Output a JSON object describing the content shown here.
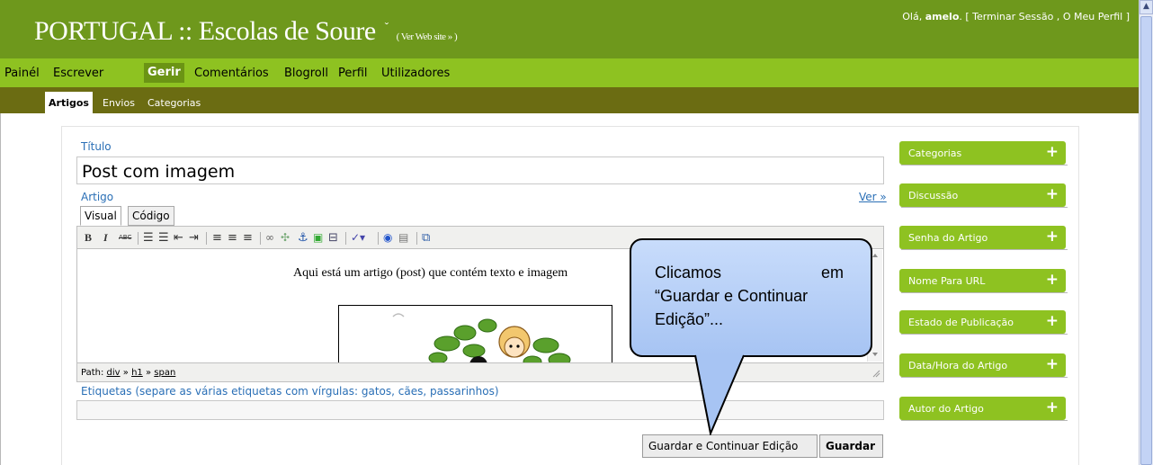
{
  "header": {
    "blog_title": "PORTUGAL :: Escolas de Soure",
    "caret": "ˇ",
    "view_site": "( Ver Web site » )",
    "greeting": "Olá,",
    "user": "amelo",
    "logout": "[ Terminar Sessão ,",
    "profile": "O Meu Perfil ]"
  },
  "mainnav": [
    "Painél",
    "Escrever",
    "Gerir",
    "Comentários",
    "Blogroll",
    "Perfil",
    "Utilizadores"
  ],
  "subnav": [
    "Artigos",
    "Envios",
    "Categorias"
  ],
  "form": {
    "title_label": "Título",
    "title_value": "Post com imagem",
    "article_label": "Artigo",
    "preview_link": "Ver »",
    "tab_visual": "Visual",
    "tab_code": "Código",
    "editor_text": "Aqui está um artigo (post) que contém texto e imagem",
    "path_label": "Path:",
    "path_div": "div",
    "path_h1": "h1",
    "path_span": "span",
    "path_sep": "»",
    "tags_label": "Etiquetas (separe as várias etiquetas com vírgulas: gatos, cães, passarinhos)",
    "tags_value": ""
  },
  "toolbar_icons": [
    "bold-icon",
    "italic-icon",
    "strikethrough-icon",
    "bullet-list-icon",
    "numbered-list-icon",
    "outdent-icon",
    "indent-icon",
    "align-left-icon",
    "align-center-icon",
    "align-right-icon",
    "link-icon",
    "unlink-icon",
    "anchor-icon",
    "image-icon",
    "more-break-icon",
    "spellcheck-icon",
    "help-icon",
    "wordcount-icon",
    "fullscreen-icon"
  ],
  "buttons": {
    "save_continue": "Guardar e Continuar Edição",
    "save": "Guardar"
  },
  "sidebar": [
    "Categorias",
    "Discussão",
    "Senha do Artigo",
    "Nome Para URL",
    "Estado de Publicação",
    "Data/Hora do Artigo",
    "Autor do Artigo"
  ],
  "callout": {
    "word1": "Clicamos",
    "word2": "em",
    "line2": "“Guardar e Continuar",
    "line3": "Edição”..."
  },
  "colors": {
    "header_green": "#6e981c",
    "nav_green": "#8ec221",
    "subnav_olive": "#6b6c12",
    "link_blue": "#2a6fb6",
    "callout_blue": "#b3cdf6"
  }
}
